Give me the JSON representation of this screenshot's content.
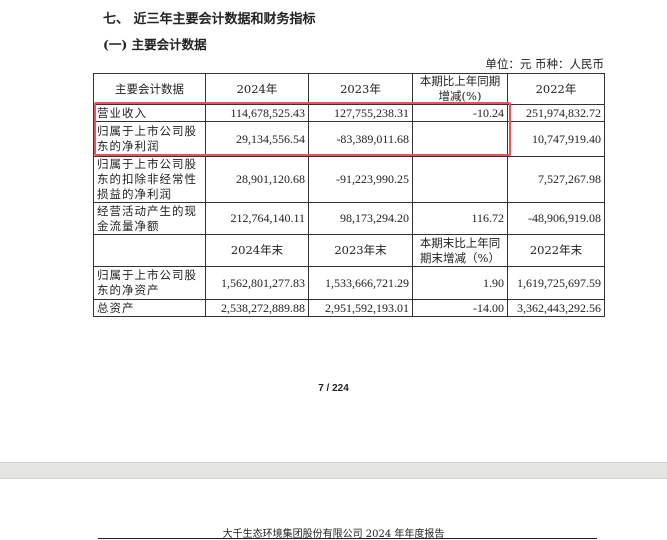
{
  "section_title": "七、 近三年主要会计数据和财务指标",
  "subsection_title": "(一) 主要会计数据",
  "unit_line": "单位：元  币种：人民币",
  "table": {
    "header1": [
      "主要会计数据",
      "2024年",
      "2023年",
      "本期比上年同期增减(%)",
      "2022年"
    ],
    "rows1": [
      [
        "营业收入",
        "114,678,525.43",
        "127,755,238.31",
        "-10.24",
        "251,974,832.72"
      ],
      [
        "归属于上市公司股东的净利润",
        "29,134,556.54",
        "-83,389,011.68",
        "",
        "10,747,919.40"
      ],
      [
        "归属于上市公司股东的扣除非经常性损益的净利润",
        "28,901,120.68",
        "-91,223,990.25",
        "",
        "7,527,267.98"
      ],
      [
        "经营活动产生的现金流量净额",
        "212,764,140.11",
        "98,173,294.20",
        "116.72",
        "-48,906,919.08"
      ]
    ],
    "header2": [
      "",
      "2024年末",
      "2023年末",
      "本期末比上年同期末增减（%）",
      "2022年末"
    ],
    "rows2": [
      [
        "归属于上市公司股东的净资产",
        "1,562,801,277.83",
        "1,533,666,721.29",
        "1.90",
        "1,619,725,697.59"
      ],
      [
        "总资产",
        "2,538,272,889.88",
        "2,951,592,193.01",
        "-14.00",
        "3,362,443,292.56"
      ]
    ]
  },
  "page_number": "7 / 224",
  "next_page_header": "大千生态环境集团股份有限公司 2024 年年度报告",
  "colors": {
    "highlight": "#f0505a"
  }
}
